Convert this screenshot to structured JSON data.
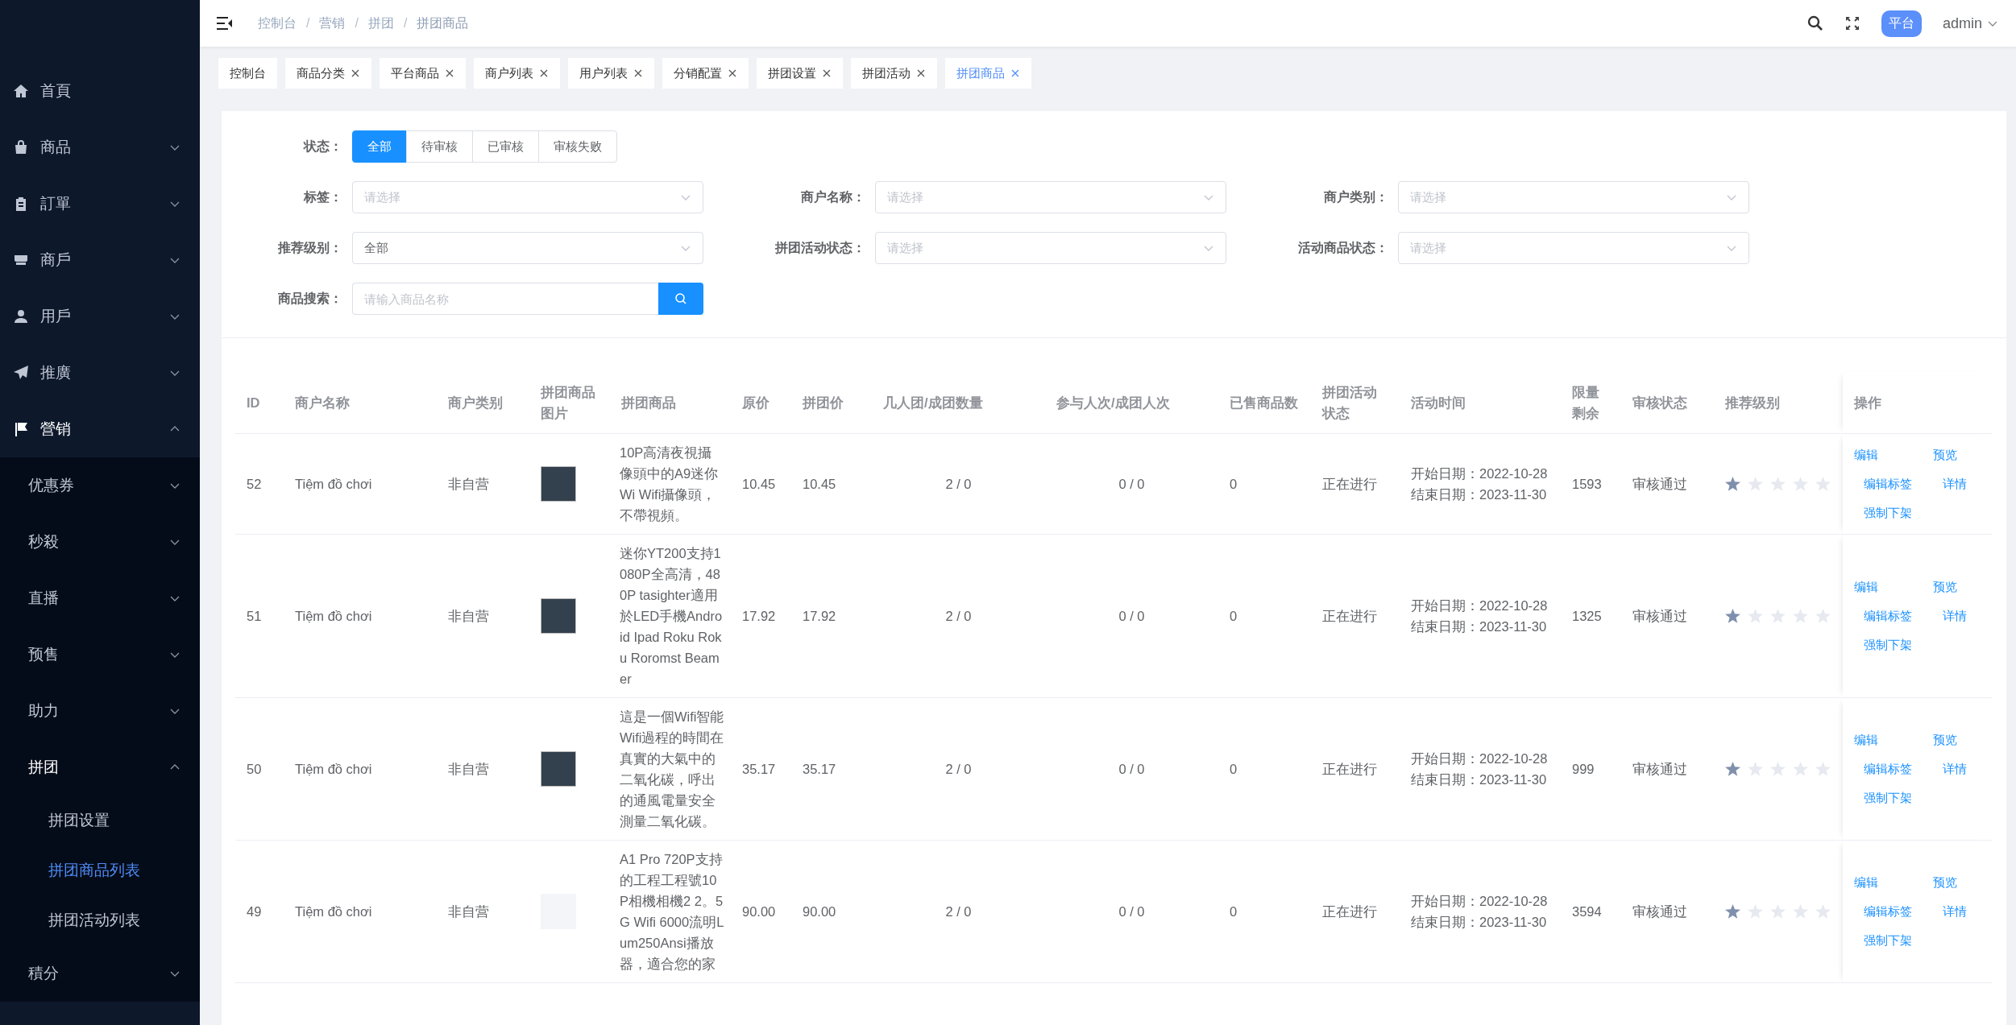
{
  "sidebar": {
    "items": [
      {
        "label": "首頁",
        "kind": "link",
        "selected": false
      },
      {
        "label": "商品",
        "kind": "submenu",
        "expanded": false
      },
      {
        "label": "訂單",
        "kind": "submenu",
        "expanded": false
      },
      {
        "label": "商戶",
        "kind": "submenu",
        "expanded": false
      },
      {
        "label": "用戶",
        "kind": "submenu",
        "expanded": false
      },
      {
        "label": "推廣",
        "kind": "submenu",
        "expanded": false
      },
      {
        "label": "營销",
        "kind": "submenu",
        "expanded": true,
        "children": [
          {
            "label": "优惠券",
            "kind": "submenu",
            "expanded": false
          },
          {
            "label": "秒殺",
            "kind": "submenu",
            "expanded": false
          },
          {
            "label": "直播",
            "kind": "submenu",
            "expanded": false
          },
          {
            "label": "预售",
            "kind": "submenu",
            "expanded": false
          },
          {
            "label": "助力",
            "kind": "submenu",
            "expanded": false
          },
          {
            "label": "拼团",
            "kind": "submenu",
            "expanded": true,
            "children": [
              {
                "label": "拼团设置",
                "kind": "link",
                "selected": false
              },
              {
                "label": "拼团商品列表",
                "kind": "link",
                "selected": true
              },
              {
                "label": "拼团活动列表",
                "kind": "link",
                "selected": false
              }
            ]
          },
          {
            "label": "積分",
            "kind": "submenu",
            "expanded": false
          }
        ]
      }
    ]
  },
  "header": {
    "breadcrumb": [
      {
        "text": "控制台",
        "kind": "link"
      },
      {
        "text": "/",
        "kind": "separator"
      },
      {
        "text": "营销",
        "kind": "link"
      },
      {
        "text": "/",
        "kind": "separator"
      },
      {
        "text": "拼团",
        "kind": "link"
      },
      {
        "text": "/",
        "kind": "separator"
      },
      {
        "text": "拼团商品",
        "kind": "current"
      }
    ],
    "role_badge": "平台",
    "user": "admin"
  },
  "tags": [
    {
      "label": "控制台",
      "closable": false,
      "selected": false
    },
    {
      "label": "商品分类",
      "closable": true,
      "selected": false
    },
    {
      "label": "平台商品",
      "closable": true,
      "selected": false
    },
    {
      "label": "商户列表",
      "closable": true,
      "selected": false
    },
    {
      "label": "用户列表",
      "closable": true,
      "selected": false
    },
    {
      "label": "分销配置",
      "closable": true,
      "selected": false
    },
    {
      "label": "拼团设置",
      "closable": true,
      "selected": false
    },
    {
      "label": "拼团活动",
      "closable": true,
      "selected": false
    },
    {
      "label": "拼团商品",
      "closable": true,
      "selected": true
    }
  ],
  "filters": {
    "status": {
      "label": "状态：",
      "options": [
        {
          "label": "全部",
          "selected": true
        },
        {
          "label": "待审核",
          "selected": false
        },
        {
          "label": "已审核",
          "selected": false
        },
        {
          "label": "审核失败",
          "selected": false
        }
      ]
    },
    "selects": [
      {
        "label": "标签：",
        "placeholder": "请选择"
      },
      {
        "label": "商户名称：",
        "placeholder": "请选择"
      },
      {
        "label": "商户类别：",
        "placeholder": "请选择"
      },
      {
        "label": "推荐级别：",
        "value": "全部"
      },
      {
        "label": "拼团活动状态：",
        "placeholder": "请选择"
      },
      {
        "label": "活动商品状态：",
        "placeholder": "请选择"
      }
    ],
    "search": {
      "label": "商品搜索：",
      "placeholder": "请输入商品名称"
    }
  },
  "table": {
    "columns": [
      "ID",
      "商户名称",
      "商户类别",
      "拼团商品图片",
      "拼团商品",
      "原价",
      "拼团价",
      "几人团/成团数量",
      "参与人次/成团人次",
      "已售商品数",
      "拼团活动状态",
      "活动时间",
      "限量剩余",
      "审核状态",
      "推荐级别",
      "操作"
    ],
    "rows": [
      {
        "id": "52",
        "merchant": "Tiệm đồ chơi",
        "merchant_type": "非自营",
        "has_image": true,
        "product": "10P高清夜視攝像頭中的A9迷你Wi Wifi攝像頭，不帶視頻。",
        "price": "10.45",
        "group_price": "10.45",
        "group_size": "2 / 0",
        "participants": "0 / 0",
        "sold": "0",
        "activity_status": "正在进行",
        "start": "开始日期：2022-10-28",
        "end": "结束日期：2023-11-30",
        "remaining": "1593",
        "review": "审核通过",
        "stars": 1,
        "actions": [
          "编辑",
          "预览",
          "编辑标签",
          "详情",
          "强制下架"
        ]
      },
      {
        "id": "51",
        "merchant": "Tiệm đồ chơi",
        "merchant_type": "非自营",
        "has_image": true,
        "product": "迷你YT200支持1080P全高清，480P tasighter適用於LED手機Android Ipad Roku Roku Roromst Beamer",
        "price": "17.92",
        "group_price": "17.92",
        "group_size": "2 / 0",
        "participants": "0 / 0",
        "sold": "0",
        "activity_status": "正在进行",
        "start": "开始日期：2022-10-28",
        "end": "结束日期：2023-11-30",
        "remaining": "1325",
        "review": "审核通过",
        "stars": 1,
        "actions": [
          "编辑",
          "预览",
          "编辑标签",
          "详情",
          "强制下架"
        ]
      },
      {
        "id": "50",
        "merchant": "Tiệm đồ chơi",
        "merchant_type": "非自营",
        "has_image": true,
        "product": "這是一個Wifi智能Wifi過程的時間在真實的大氣中的二氧化碳，呼出的通風電量安全測量二氧化碳。",
        "price": "35.17",
        "group_price": "35.17",
        "group_size": "2 / 0",
        "participants": "0 / 0",
        "sold": "0",
        "activity_status": "正在进行",
        "start": "开始日期：2022-10-28",
        "end": "结束日期：2023-11-30",
        "remaining": "999",
        "review": "审核通过",
        "stars": 1,
        "actions": [
          "编辑",
          "预览",
          "编辑标签",
          "详情",
          "强制下架"
        ]
      },
      {
        "id": "49",
        "merchant": "Tiệm đồ chơi",
        "merchant_type": "非自营",
        "has_image": false,
        "product": "A1 Pro 720P支持的工程工程號10P相機相機2 2。5G Wifi 6000流明Lum250Ansi播放器，適合您的家",
        "price": "90.00",
        "group_price": "90.00",
        "group_size": "2 / 0",
        "participants": "0 / 0",
        "sold": "0",
        "activity_status": "正在进行",
        "start": "开始日期：2022-10-28",
        "end": "结束日期：2023-11-30",
        "remaining": "3594",
        "review": "审核通过",
        "stars": 1,
        "actions": [
          "编辑",
          "预览",
          "编辑标签",
          "详情",
          "强制下架"
        ]
      }
    ]
  }
}
